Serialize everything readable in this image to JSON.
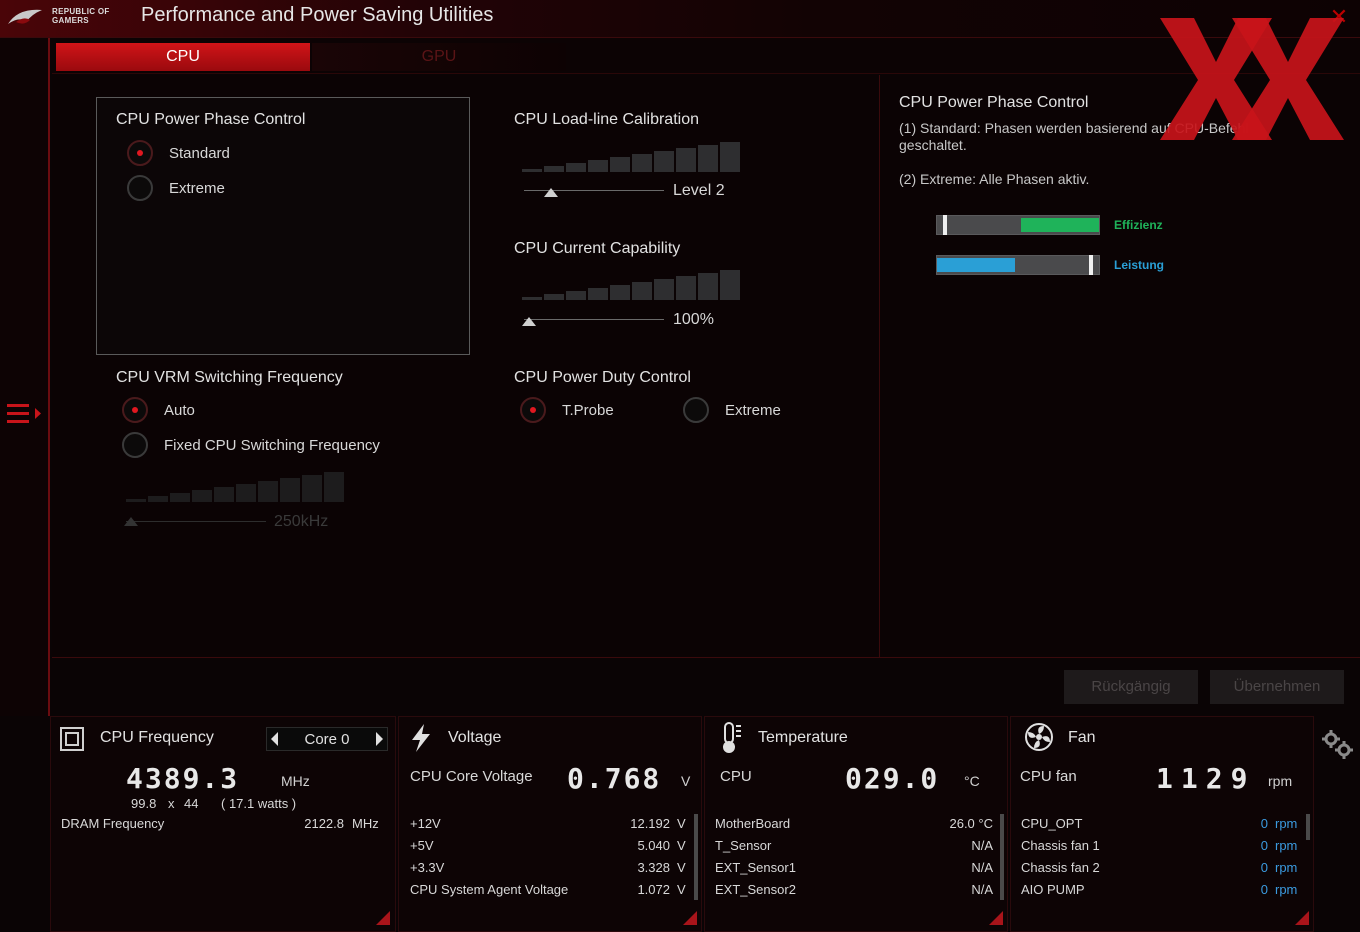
{
  "app": {
    "brand_line1": "REPUBLIC OF",
    "brand_line2": "GAMERS",
    "title": "Performance and Power Saving Utilities"
  },
  "tabs": [
    {
      "label": "CPU",
      "active": true
    },
    {
      "label": "GPU",
      "active": false
    }
  ],
  "phase_control": {
    "title": "CPU Power Phase Control",
    "options": [
      {
        "label": "Standard",
        "checked": true
      },
      {
        "label": "Extreme",
        "checked": false
      }
    ]
  },
  "vrm_frequency": {
    "title": "CPU VRM Switching Frequency",
    "options": [
      {
        "label": "Auto",
        "checked": true
      },
      {
        "label": "Fixed CPU Switching Frequency",
        "checked": false
      }
    ],
    "slider_value": "250kHz"
  },
  "load_line": {
    "title": "CPU Load-line Calibration",
    "slider_value": "Level 2"
  },
  "current_capability": {
    "title": "CPU Current Capability",
    "slider_value": "100%"
  },
  "duty_control": {
    "title": "CPU Power Duty Control",
    "options": [
      {
        "label": "T.Probe",
        "checked": true
      },
      {
        "label": "Extreme",
        "checked": false
      }
    ]
  },
  "info": {
    "title": "CPU Power Phase Control",
    "line1": "(1) Standard: Phasen werden basierend auf CPU-Befehl geschaltet.",
    "line2": "(2) Extreme: Alle Phasen aktiv.",
    "efficiency_label": "Effizienz",
    "performance_label": "Leistung",
    "efficiency_color": "#1fb35a",
    "performance_color": "#2a9fd6",
    "efficiency_level": 0.48,
    "performance_level": 0.48
  },
  "actions": {
    "undo": "Rückgängig",
    "apply": "Übernehmen"
  },
  "monitor": {
    "cpu_freq": {
      "title": "CPU Frequency",
      "core": "Core 0",
      "value": "4389.3",
      "unit": "MHz",
      "multiplier_a": "99.8",
      "multiplier_x": "x",
      "multiplier_b": "44",
      "watts": "( 17.1 watts )",
      "dram_label": "DRAM Frequency",
      "dram_value": "2122.8",
      "dram_unit": "MHz"
    },
    "voltage": {
      "title": "Voltage",
      "main_label": "CPU Core Voltage",
      "main_value": "0.768",
      "main_unit": "V",
      "rows": [
        {
          "label": "+12V",
          "value": "12.192",
          "unit": "V"
        },
        {
          "label": "+5V",
          "value": "5.040",
          "unit": "V"
        },
        {
          "label": "+3.3V",
          "value": "3.328",
          "unit": "V"
        },
        {
          "label": "CPU System Agent Voltage",
          "value": "1.072",
          "unit": "V"
        }
      ]
    },
    "temperature": {
      "title": "Temperature",
      "main_label": "CPU",
      "main_value": "029.0",
      "main_unit": "°C",
      "rows": [
        {
          "label": "MotherBoard",
          "value": "26.0 °C"
        },
        {
          "label": "T_Sensor",
          "value": "N/A"
        },
        {
          "label": "EXT_Sensor1",
          "value": "N/A"
        },
        {
          "label": "EXT_Sensor2",
          "value": "N/A"
        }
      ]
    },
    "fan": {
      "title": "Fan",
      "main_label": "CPU fan",
      "main_value": "1129",
      "main_unit": "rpm",
      "rows": [
        {
          "label": "CPU_OPT",
          "value": "0",
          "unit": "rpm"
        },
        {
          "label": "Chassis fan 1",
          "value": "0",
          "unit": "rpm"
        },
        {
          "label": "Chassis fan 2",
          "value": "0",
          "unit": "rpm"
        },
        {
          "label": "AIO PUMP",
          "value": "0",
          "unit": "rpm"
        }
      ]
    }
  },
  "icons": {
    "logo": "rog-eye-icon",
    "close": "close-icon",
    "menu": "menu-icon",
    "settings": "gear-icon",
    "cpu": "chip-icon",
    "voltage": "lightning-icon",
    "temperature": "thermometer-icon",
    "fan": "fan-icon"
  },
  "accent_color": "#c8141a"
}
